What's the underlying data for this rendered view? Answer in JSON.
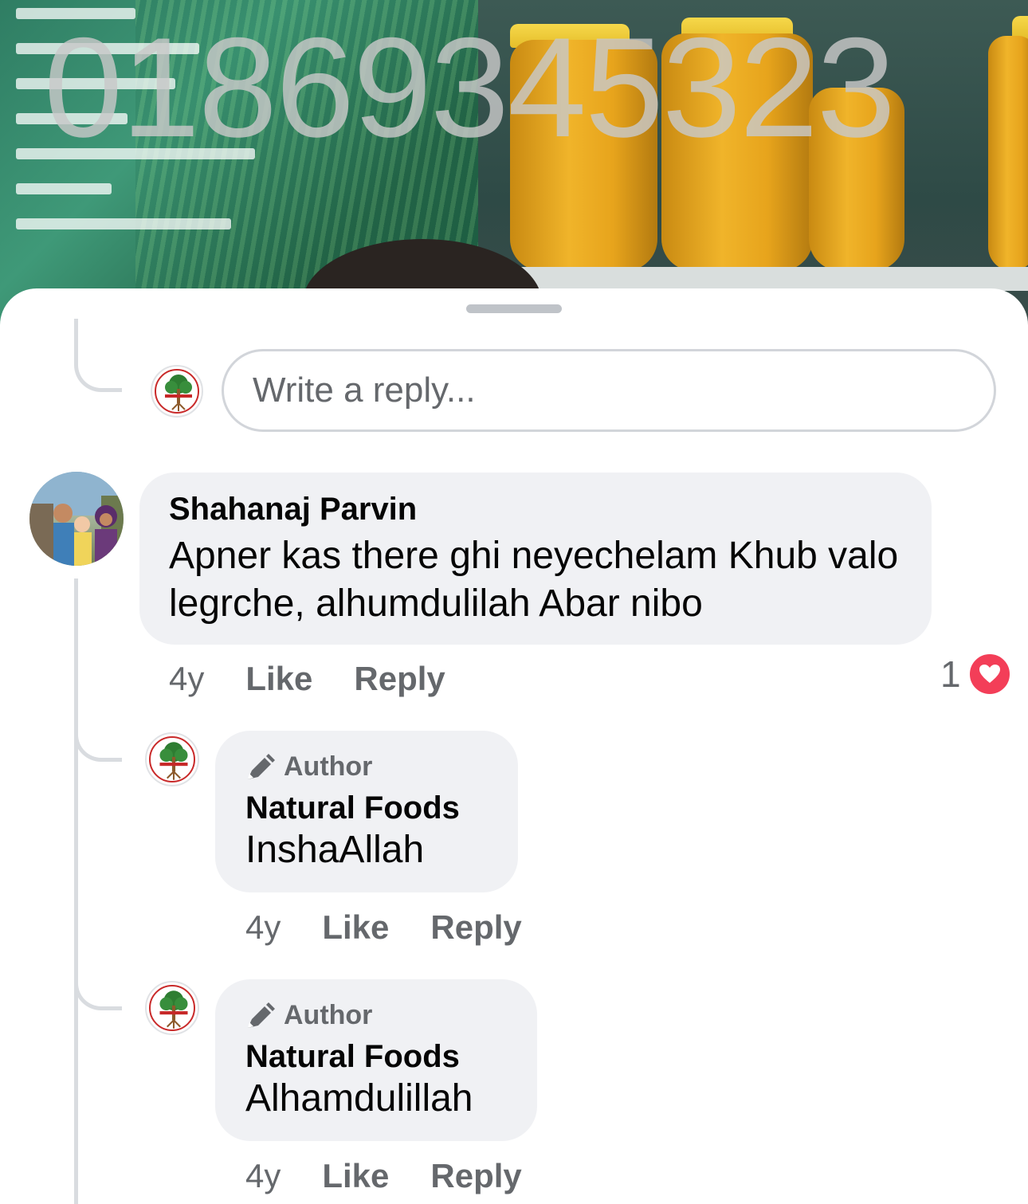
{
  "background": {
    "overlay_number": "01869345323",
    "banner_lines": [
      "",
      "",
      "",
      "",
      "",
      "",
      ""
    ]
  },
  "reply_box": {
    "placeholder": "Write a reply..."
  },
  "comments": [
    {
      "name": "Shahanaj Parvin",
      "text": "Apner kas there ghi neyechelam Khub valo legrche, alhumdulilah Abar nibo",
      "time": "4y",
      "like": "Like",
      "reply": "Reply",
      "reaction_count": "1",
      "reaction_icon": "heart-icon",
      "reaction_color": "#f33e58"
    }
  ],
  "replies": [
    {
      "badge": "Author",
      "badge_icon": "pen-icon",
      "name": "Natural Foods",
      "text": "InshaAllah",
      "time": "4y",
      "like": "Like",
      "reply": "Reply"
    },
    {
      "badge": "Author",
      "badge_icon": "pen-icon",
      "name": "Natural Foods",
      "text": "Alhamdulillah",
      "time": "4y",
      "like": "Like",
      "reply": "Reply"
    }
  ]
}
